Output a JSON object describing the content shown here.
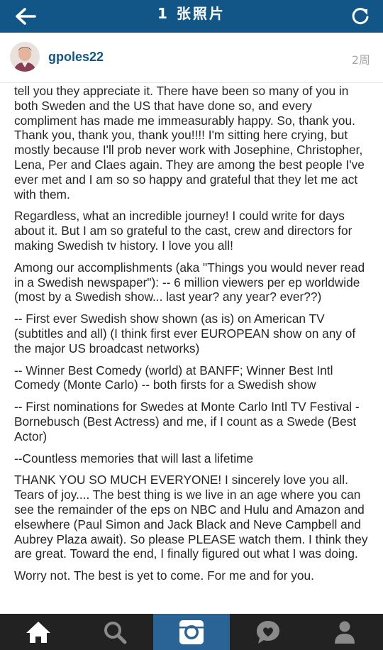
{
  "header": {
    "title": "1 张照片",
    "back_icon": "arrow-left-icon",
    "refresh_icon": "refresh-icon"
  },
  "post": {
    "username": "gpoles22",
    "age": "2周",
    "caption_paragraphs": [
      "tell you they appreciate it. There have been so many of you in both Sweden and the US that have done so, and every compliment has made me immeasurably happy. So, thank you. Thank you, thank you, thank you!!!! I'm sitting here crying, but mostly because I'll prob never work with Josephine, Christopher, Lena, Per and Claes again. They are among the best people I've ever met and I am so so happy and grateful that they let me act with them.",
      "Regardless, what an incredible journey! I could write for days about it. But I am so grateful to the cast, crew and directors for making Swedish tv history. I love you all!",
      "Among our accomplishments (aka \"Things you would never read in a Swedish newspaper\"): -- 6 million viewers per ep worldwide (most by a Swedish show... last year? any year? ever??)",
      "-- First ever Swedish show shown (as is) on American TV (subtitles and all) (I think first ever EUROPEAN show on any of the major US broadcast networks)",
      "-- Winner Best Comedy (world) at BANFF; Winner Best Intl Comedy (Monte Carlo) -- both firsts for a Swedish show",
      "-- First nominations for Swedes at Monte Carlo Intl TV Festival - Bornebusch (Best Actress) and me, if I count as a Swede (Best Actor)",
      "--Countless memories that will last a lifetime",
      "THANK YOU SO MUCH EVERYONE! I sincerely love you all. Tears of joy.... The best thing is we live in an age where you can see the remainder of the eps on NBC and Hulu and Amazon and elsewhere (Paul Simon and Jack Black and Neve Campbell and Aubrey Plaza await). So please PLEASE watch them. I think they are great. Toward the end, I finally figured out what I was doing.",
      "Worry not. The best is yet to come. For me and for you."
    ]
  },
  "tabs": [
    {
      "icon": "home-icon",
      "active": false
    },
    {
      "icon": "search-icon",
      "active": false
    },
    {
      "icon": "camera-icon",
      "active": true
    },
    {
      "icon": "activity-heart-icon",
      "active": false
    },
    {
      "icon": "profile-icon",
      "active": false
    }
  ],
  "colors": {
    "header_bg": "#125688",
    "username": "#125688",
    "tabbar_bg": "#222222",
    "tab_active_bg": "#2a6496"
  }
}
